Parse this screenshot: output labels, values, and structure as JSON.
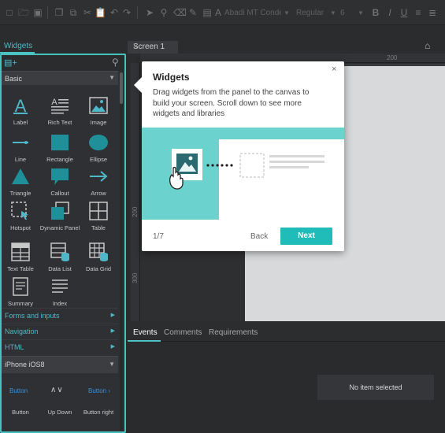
{
  "toolbar": {
    "font_family": "Abadi MT Conden",
    "font_weight": "Regular",
    "font_size": "6",
    "bold": "B",
    "italic": "I",
    "underline": "U"
  },
  "widgets_panel": {
    "tab_label": "Widgets",
    "categories": {
      "basic": "Basic",
      "forms": "Forms and inputs",
      "navigation": "Navigation",
      "html": "HTML",
      "ios": "iPhone iOS8"
    },
    "items": [
      {
        "label": "Label",
        "icon": "label-icon"
      },
      {
        "label": "Rich Text",
        "icon": "rich-text-icon"
      },
      {
        "label": "Image",
        "icon": "image-icon"
      },
      {
        "label": "Line",
        "icon": "line-icon"
      },
      {
        "label": "Rectangle",
        "icon": "rectangle-icon"
      },
      {
        "label": "Ellipse",
        "icon": "ellipse-icon"
      },
      {
        "label": "Triangle",
        "icon": "triangle-icon"
      },
      {
        "label": "Callout",
        "icon": "callout-icon"
      },
      {
        "label": "Arrow",
        "icon": "arrow-icon"
      },
      {
        "label": "Hotspot",
        "icon": "hotspot-icon"
      },
      {
        "label": "Dynamic Panel",
        "icon": "dynamic-panel-icon"
      },
      {
        "label": "Table",
        "icon": "table-icon"
      },
      {
        "label": "Text Table",
        "icon": "text-table-icon"
      },
      {
        "label": "Data List",
        "icon": "data-list-icon"
      },
      {
        "label": "Data Grid",
        "icon": "data-grid-icon"
      },
      {
        "label": "Summary",
        "icon": "summary-icon"
      },
      {
        "label": "Index",
        "icon": "index-icon"
      }
    ],
    "ios_items": [
      {
        "label": "Button",
        "preview": "Button"
      },
      {
        "label": "Up Down",
        "preview": "∧∨"
      },
      {
        "label": "Button right",
        "preview": "Button ›"
      }
    ]
  },
  "screen_tab": {
    "label": "Screen 1",
    "close": "×"
  },
  "rulers": {
    "h_200": "200",
    "v_200": "200",
    "v_300": "300"
  },
  "popover": {
    "title": "Widgets",
    "close": "×",
    "body": "Drag widgets from the panel to the canvas to build your screen. Scroll down to see more widgets and libraries",
    "step": "1/7",
    "back": "Back",
    "next": "Next"
  },
  "bottom_panel": {
    "tabs": [
      "Events",
      "Comments",
      "Requirements"
    ],
    "empty_message": "No item selected"
  },
  "colors": {
    "accent": "#47c3bf",
    "link": "#4fb8c8",
    "next_button": "#1fbcb9",
    "illustration_bg": "#6cd2cd"
  }
}
